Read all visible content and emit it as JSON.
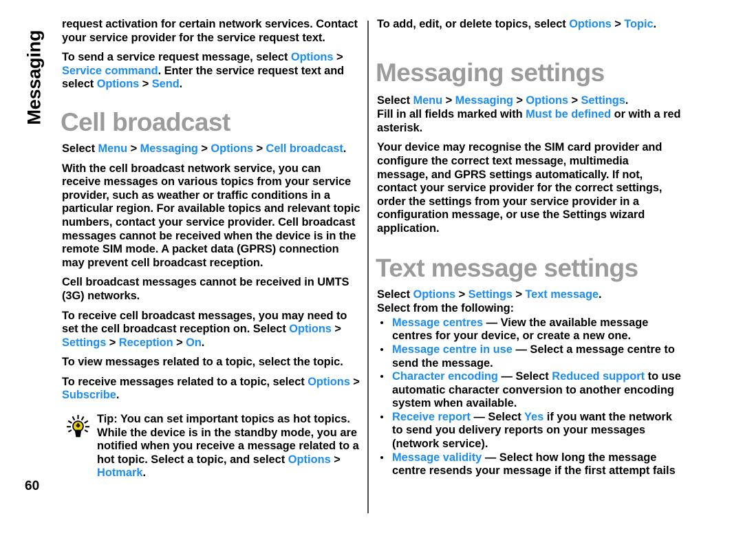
{
  "page": {
    "chapter_tab": "Messaging",
    "folio": "60",
    "accent_link_color": "#1b8cf2",
    "heading_color": "#9b9b9b",
    "body_color": "#000000"
  },
  "left_column": {
    "paragraphs": [
      {
        "id": "p-service-request",
        "runs": [
          {
            "t": "request activation for certain network services. Contact your service provider for the service request text.",
            "s": "plain"
          }
        ]
      },
      {
        "id": "p-send-service-request",
        "runs": [
          {
            "t": "To send a service request message, select ",
            "s": "plain"
          },
          {
            "t": "Options",
            "s": "link"
          },
          {
            "t": " > ",
            "s": "sep"
          },
          {
            "t": "Service command",
            "s": "link"
          },
          {
            "t": ". Enter the service request text and select ",
            "s": "plain"
          },
          {
            "t": "Options",
            "s": "link"
          },
          {
            "t": " > ",
            "s": "sep"
          },
          {
            "t": "Send",
            "s": "link"
          },
          {
            "t": ".",
            "s": "plain"
          }
        ]
      }
    ],
    "heading": "Cell broadcast",
    "after_heading": [
      {
        "id": "p-cell-path",
        "runs": [
          {
            "t": "Select ",
            "s": "plain"
          },
          {
            "t": "Menu",
            "s": "link"
          },
          {
            "t": " > ",
            "s": "sep"
          },
          {
            "t": "Messaging",
            "s": "link"
          },
          {
            "t": " > ",
            "s": "sep"
          },
          {
            "t": "Options",
            "s": "link"
          },
          {
            "t": " > ",
            "s": "sep"
          },
          {
            "t": "Cell broadcast",
            "s": "link"
          },
          {
            "t": ".",
            "s": "plain"
          }
        ]
      },
      {
        "id": "p-cell-desc",
        "runs": [
          {
            "t": "With the cell broadcast network service, you can receive messages on various topics from your service provider, such as weather or traffic conditions in a particular region. For available topics and relevant topic numbers, contact your service provider. Cell broadcast messages cannot be received when the device is in the remote SIM mode. A packet data (GPRS) connection may prevent cell broadcast reception.",
            "s": "plain"
          }
        ]
      },
      {
        "id": "p-umts",
        "runs": [
          {
            "t": "Cell broadcast messages cannot be received in UMTS (3G) networks.",
            "s": "plain"
          }
        ]
      },
      {
        "id": "p-reception-on",
        "runs": [
          {
            "t": "To receive cell broadcast messages, you may need to set the cell broadcast reception on. Select ",
            "s": "plain"
          },
          {
            "t": "Options",
            "s": "link"
          },
          {
            "t": " > ",
            "s": "sep"
          },
          {
            "t": "Settings",
            "s": "link"
          },
          {
            "t": " > ",
            "s": "sep"
          },
          {
            "t": "Reception",
            "s": "link"
          },
          {
            "t": " > ",
            "s": "sep"
          },
          {
            "t": "On",
            "s": "link"
          },
          {
            "t": ".",
            "s": "plain"
          }
        ]
      },
      {
        "id": "p-view-topic",
        "runs": [
          {
            "t": "To view messages related to a topic, select the topic.",
            "s": "plain"
          }
        ]
      },
      {
        "id": "p-subscribe",
        "runs": [
          {
            "t": "To receive messages related to a topic, select ",
            "s": "plain"
          },
          {
            "t": "Options",
            "s": "link"
          },
          {
            "t": " > ",
            "s": "sep"
          },
          {
            "t": "Subscribe",
            "s": "link"
          },
          {
            "t": ".",
            "s": "plain"
          }
        ]
      }
    ],
    "tip": {
      "icon": "lightbulb-icon",
      "runs": [
        {
          "t": "Tip: ",
          "s": "plain"
        },
        {
          "t": "You can set important topics as hot topics. While the device is in the standby mode, you are notified when you receive a message related to a hot topic. Select a topic, and select ",
          "s": "plain"
        },
        {
          "t": "Options",
          "s": "link"
        },
        {
          "t": " > ",
          "s": "sep"
        },
        {
          "t": "Hotmark",
          "s": "link"
        },
        {
          "t": ".",
          "s": "plain"
        }
      ]
    }
  },
  "right_column": {
    "top_paragraph": {
      "id": "p-topics",
      "runs": [
        {
          "t": "To add, edit, or delete topics, select ",
          "s": "plain"
        },
        {
          "t": "Options",
          "s": "link"
        },
        {
          "t": " > ",
          "s": "sep"
        },
        {
          "t": "Topic",
          "s": "link"
        },
        {
          "t": ".",
          "s": "plain"
        }
      ]
    },
    "heading_messaging_settings": "Messaging settings",
    "messaging_settings_paragraphs": [
      {
        "id": "p-settings-path",
        "runs": [
          {
            "t": "Select ",
            "s": "plain"
          },
          {
            "t": "Menu",
            "s": "link"
          },
          {
            "t": " > ",
            "s": "sep"
          },
          {
            "t": "Messaging",
            "s": "link"
          },
          {
            "t": " > ",
            "s": "sep"
          },
          {
            "t": "Options",
            "s": "link"
          },
          {
            "t": " > ",
            "s": "sep"
          },
          {
            "t": "Settings",
            "s": "link"
          },
          {
            "t": ".",
            "s": "plain"
          }
        ]
      },
      {
        "id": "p-must-be-defined",
        "runs": [
          {
            "t": "Fill in all fields marked with ",
            "s": "plain"
          },
          {
            "t": "Must be defined",
            "s": "link"
          },
          {
            "t": " or with a red asterisk.",
            "s": "plain"
          }
        ]
      },
      {
        "id": "p-recognise-sim",
        "runs": [
          {
            "t": "Your device may recognise the SIM card provider and configure the correct text message, multimedia message, and GPRS settings automatically. If not, contact your service provider for the correct settings, order the settings from your service provider in a configuration message, or use the Settings wizard application.",
            "s": "plain"
          }
        ]
      }
    ],
    "heading_text_message_settings": "Text message settings",
    "text_message_paragraphs": [
      {
        "id": "p-textmsg-path",
        "runs": [
          {
            "t": "Select ",
            "s": "plain"
          },
          {
            "t": "Options",
            "s": "link"
          },
          {
            "t": " > ",
            "s": "sep"
          },
          {
            "t": "Settings",
            "s": "link"
          },
          {
            "t": " > ",
            "s": "sep"
          },
          {
            "t": "Text message",
            "s": "link"
          },
          {
            "t": ".",
            "s": "plain"
          }
        ]
      },
      {
        "id": "p-select-following",
        "runs": [
          {
            "t": "Select from the following:",
            "s": "plain"
          }
        ]
      }
    ],
    "bullets": [
      {
        "id": "bullet-message-centres",
        "runs": [
          {
            "t": "Message centres",
            "s": "link"
          },
          {
            "t": " — View the available message centres for your device, or create a new one.",
            "s": "plain"
          }
        ]
      },
      {
        "id": "bullet-message-centre-in-use",
        "runs": [
          {
            "t": "Message centre in use",
            "s": "link"
          },
          {
            "t": " — Select a message centre to send the message.",
            "s": "plain"
          }
        ]
      },
      {
        "id": "bullet-character-encoding",
        "runs": [
          {
            "t": "Character encoding",
            "s": "link"
          },
          {
            "t": " — Select ",
            "s": "plain"
          },
          {
            "t": "Reduced support",
            "s": "link"
          },
          {
            "t": " to use automatic character conversion to another encoding system when available.",
            "s": "plain"
          }
        ]
      },
      {
        "id": "bullet-receive-report",
        "runs": [
          {
            "t": "Receive report",
            "s": "link"
          },
          {
            "t": " — Select ",
            "s": "plain"
          },
          {
            "t": "Yes",
            "s": "link"
          },
          {
            "t": " if you want the network to send you delivery reports on your messages (network service).",
            "s": "plain"
          }
        ]
      },
      {
        "id": "bullet-message-validity",
        "runs": [
          {
            "t": "Message validity",
            "s": "link"
          },
          {
            "t": " — Select how long the message centre resends your message if the first attempt fails",
            "s": "plain"
          }
        ]
      }
    ]
  }
}
